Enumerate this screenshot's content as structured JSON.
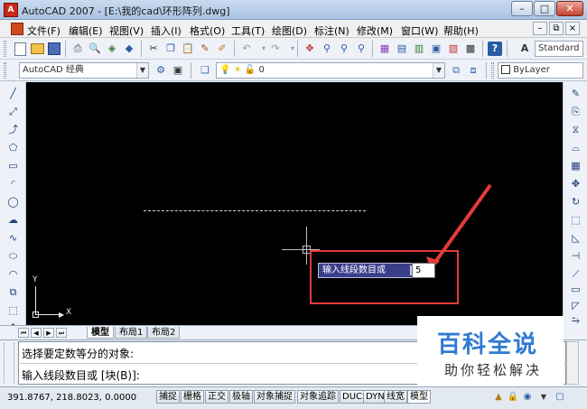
{
  "window": {
    "title": "AutoCAD 2007 - [E:\\我的cad\\环形阵列.dwg]",
    "app_icon_glyph": "A"
  },
  "window_controls": {
    "minimize": "–",
    "maximize": "□",
    "close": "✕"
  },
  "menubar": {
    "items": [
      "文件(F)",
      "编辑(E)",
      "视图(V)",
      "插入(I)",
      "格式(O)",
      "工具(T)",
      "绘图(D)",
      "标注(N)",
      "修改(M)",
      "窗口(W)",
      "帮助(H)"
    ],
    "doc_controls": {
      "minimize": "–",
      "restore": "⧉",
      "close": "×"
    }
  },
  "toolbar": {
    "text_style": "Standard",
    "workspace": "AutoCAD 经典",
    "layer": "0",
    "linetype": "ByLayer"
  },
  "drawing": {
    "ucs_x_label": "X",
    "ucs_y_label": "Y",
    "dynamic_prompt": "输入线段数目或",
    "dynamic_input_value": "5",
    "accent_color": "#e23b3b"
  },
  "layout_tabs": [
    "模型",
    "布局1",
    "布局2"
  ],
  "command": {
    "line1": "选择要定数等分的对象:",
    "line2": "输入线段数目或 [块(B)]:"
  },
  "watermark": {
    "title": "百科全说",
    "subtitle": "助你轻松解决"
  },
  "status": {
    "coordinates": "391.8767, 218.8023, 0.0000",
    "buttons": [
      "捕捉",
      "栅格",
      "正交",
      "极轴",
      "对象捕捉",
      "对象追踪",
      "DUCS",
      "DYN",
      "线宽",
      "模型"
    ]
  }
}
